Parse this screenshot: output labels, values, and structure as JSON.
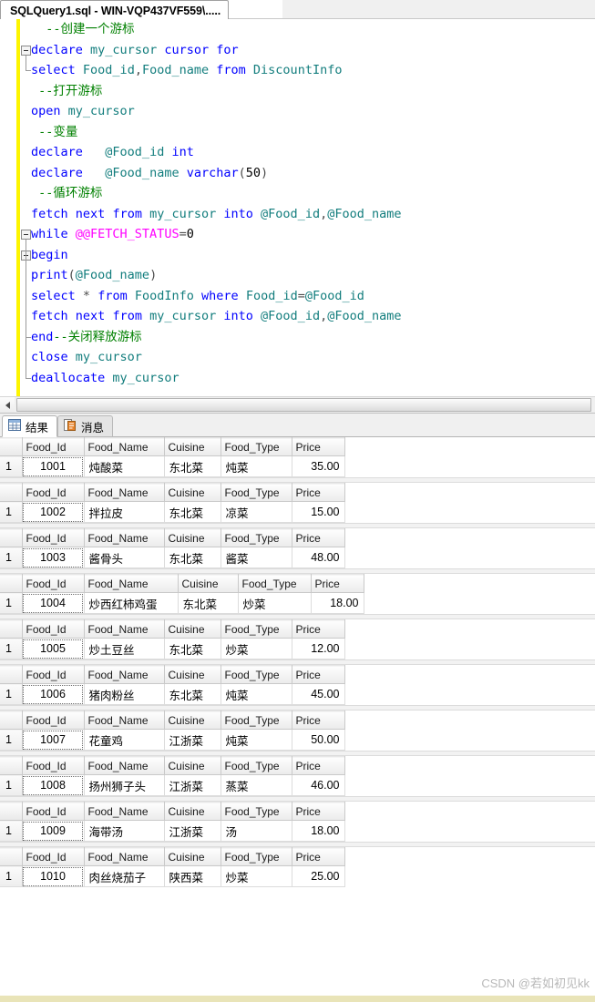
{
  "window": {
    "tab_title": "SQLQuery1.sql - WIN-VQP437VF559\\....."
  },
  "editor": {
    "lines": [
      {
        "glyph": "none",
        "segments": [
          {
            "t": "  --创建一个游标",
            "c": "cmt"
          }
        ]
      },
      {
        "glyph": "box",
        "segments": [
          {
            "t": "declare",
            "c": "kw"
          },
          {
            "t": " ",
            "c": "plain"
          },
          {
            "t": "my_cursor",
            "c": "id"
          },
          {
            "t": " ",
            "c": "plain"
          },
          {
            "t": "cursor",
            "c": "kw"
          },
          {
            "t": " ",
            "c": "plain"
          },
          {
            "t": "for",
            "c": "kw"
          }
        ]
      },
      {
        "glyph": "tick",
        "segments": [
          {
            "t": "select",
            "c": "kw"
          },
          {
            "t": " ",
            "c": "plain"
          },
          {
            "t": "Food_id",
            "c": "id"
          },
          {
            "t": ",",
            "c": "op"
          },
          {
            "t": "Food_name",
            "c": "id"
          },
          {
            "t": " ",
            "c": "plain"
          },
          {
            "t": "from",
            "c": "kw"
          },
          {
            "t": " ",
            "c": "plain"
          },
          {
            "t": "DiscountInfo",
            "c": "id"
          }
        ]
      },
      {
        "glyph": "none",
        "segments": [
          {
            "t": " --打开游标",
            "c": "cmt"
          }
        ]
      },
      {
        "glyph": "none",
        "segments": [
          {
            "t": "open",
            "c": "kw"
          },
          {
            "t": " ",
            "c": "plain"
          },
          {
            "t": "my_cursor",
            "c": "id"
          }
        ]
      },
      {
        "glyph": "none",
        "segments": [
          {
            "t": " --变量",
            "c": "cmt"
          }
        ]
      },
      {
        "glyph": "none",
        "segments": [
          {
            "t": "declare",
            "c": "kw"
          },
          {
            "t": "   ",
            "c": "plain"
          },
          {
            "t": "@Food_id",
            "c": "id"
          },
          {
            "t": " ",
            "c": "plain"
          },
          {
            "t": "int",
            "c": "kw"
          }
        ]
      },
      {
        "glyph": "none",
        "segments": [
          {
            "t": "declare",
            "c": "kw"
          },
          {
            "t": "   ",
            "c": "plain"
          },
          {
            "t": "@Food_name",
            "c": "id"
          },
          {
            "t": " ",
            "c": "plain"
          },
          {
            "t": "varchar",
            "c": "kw"
          },
          {
            "t": "(",
            "c": "op"
          },
          {
            "t": "50",
            "c": "num"
          },
          {
            "t": ")",
            "c": "op"
          }
        ]
      },
      {
        "glyph": "none",
        "segments": [
          {
            "t": " --循环游标",
            "c": "cmt"
          }
        ]
      },
      {
        "glyph": "none",
        "segments": [
          {
            "t": "fetch",
            "c": "kw"
          },
          {
            "t": " ",
            "c": "plain"
          },
          {
            "t": "next",
            "c": "kw"
          },
          {
            "t": " ",
            "c": "plain"
          },
          {
            "t": "from",
            "c": "kw"
          },
          {
            "t": " ",
            "c": "plain"
          },
          {
            "t": "my_cursor",
            "c": "id"
          },
          {
            "t": " ",
            "c": "plain"
          },
          {
            "t": "into",
            "c": "kw"
          },
          {
            "t": " ",
            "c": "plain"
          },
          {
            "t": "@Food_id",
            "c": "id"
          },
          {
            "t": ",",
            "c": "op"
          },
          {
            "t": "@Food_name",
            "c": "id"
          }
        ]
      },
      {
        "glyph": "box",
        "segments": [
          {
            "t": "while",
            "c": "kw"
          },
          {
            "t": " ",
            "c": "plain"
          },
          {
            "t": "@@FETCH_STATUS",
            "c": "gv"
          },
          {
            "t": "=",
            "c": "op"
          },
          {
            "t": "0",
            "c": "num"
          }
        ]
      },
      {
        "glyph": "box",
        "segments": [
          {
            "t": "begin",
            "c": "kw"
          }
        ]
      },
      {
        "glyph": "none",
        "segments": [
          {
            "t": "print",
            "c": "kw"
          },
          {
            "t": "(",
            "c": "op"
          },
          {
            "t": "@Food_name",
            "c": "id"
          },
          {
            "t": ")",
            "c": "op"
          }
        ]
      },
      {
        "glyph": "none",
        "segments": [
          {
            "t": "select",
            "c": "kw"
          },
          {
            "t": " ",
            "c": "plain"
          },
          {
            "t": "*",
            "c": "op"
          },
          {
            "t": " ",
            "c": "plain"
          },
          {
            "t": "from",
            "c": "kw"
          },
          {
            "t": " ",
            "c": "plain"
          },
          {
            "t": "FoodInfo",
            "c": "id"
          },
          {
            "t": " ",
            "c": "plain"
          },
          {
            "t": "where",
            "c": "kw"
          },
          {
            "t": " ",
            "c": "plain"
          },
          {
            "t": "Food_id",
            "c": "id"
          },
          {
            "t": "=",
            "c": "op"
          },
          {
            "t": "@Food_id",
            "c": "id"
          }
        ]
      },
      {
        "glyph": "none",
        "segments": [
          {
            "t": "fetch",
            "c": "kw"
          },
          {
            "t": " ",
            "c": "plain"
          },
          {
            "t": "next",
            "c": "kw"
          },
          {
            "t": " ",
            "c": "plain"
          },
          {
            "t": "from",
            "c": "kw"
          },
          {
            "t": " ",
            "c": "plain"
          },
          {
            "t": "my_cursor",
            "c": "id"
          },
          {
            "t": " ",
            "c": "plain"
          },
          {
            "t": "into",
            "c": "kw"
          },
          {
            "t": " ",
            "c": "plain"
          },
          {
            "t": "@Food_id",
            "c": "id"
          },
          {
            "t": ",",
            "c": "op"
          },
          {
            "t": "@Food_name",
            "c": "id"
          }
        ]
      },
      {
        "glyph": "tick",
        "segments": [
          {
            "t": "end",
            "c": "kw"
          },
          {
            "t": "--关闭释放游标",
            "c": "cmt"
          }
        ]
      },
      {
        "glyph": "none",
        "segments": [
          {
            "t": "close",
            "c": "kw"
          },
          {
            "t": " ",
            "c": "plain"
          },
          {
            "t": "my_cursor",
            "c": "id"
          }
        ]
      },
      {
        "glyph": "end",
        "segments": [
          {
            "t": "deallocate",
            "c": "kw"
          },
          {
            "t": " ",
            "c": "plain"
          },
          {
            "t": "my_cursor",
            "c": "id"
          }
        ]
      }
    ]
  },
  "results_tabs": [
    {
      "label": "结果",
      "icon": "grid-icon",
      "active": true
    },
    {
      "label": "消息",
      "icon": "messages-icon",
      "active": false
    }
  ],
  "grid": {
    "columns": [
      "Food_Id",
      "Food_Name",
      "Cuisine",
      "Food_Type",
      "Price"
    ],
    "row_number": "1",
    "result_sets": [
      {
        "widths": [
          68,
          88,
          62,
          78,
          58
        ],
        "cells": [
          "1001",
          "炖酸菜",
          "东北菜",
          "炖菜",
          "35.00"
        ]
      },
      {
        "widths": [
          68,
          88,
          62,
          78,
          58
        ],
        "cells": [
          "1002",
          "拌拉皮",
          "东北菜",
          "凉菜",
          "15.00"
        ]
      },
      {
        "widths": [
          68,
          88,
          62,
          78,
          58
        ],
        "cells": [
          "1003",
          "酱骨头",
          "东北菜",
          "酱菜",
          "48.00"
        ]
      },
      {
        "widths": [
          68,
          103,
          66,
          80,
          58
        ],
        "cells": [
          "1004",
          "炒西红柿鸡蛋",
          "东北菜",
          "炒菜",
          "18.00"
        ]
      },
      {
        "widths": [
          68,
          88,
          62,
          78,
          58
        ],
        "cells": [
          "1005",
          "炒土豆丝",
          "东北菜",
          "炒菜",
          "12.00"
        ]
      },
      {
        "widths": [
          68,
          88,
          62,
          78,
          58
        ],
        "cells": [
          "1006",
          "猪肉粉丝",
          "东北菜",
          "炖菜",
          "45.00"
        ]
      },
      {
        "widths": [
          68,
          88,
          62,
          78,
          58
        ],
        "cells": [
          "1007",
          "花童鸡",
          "江浙菜",
          "炖菜",
          "50.00"
        ]
      },
      {
        "widths": [
          68,
          88,
          62,
          78,
          58
        ],
        "cells": [
          "1008",
          "扬州狮子头",
          "江浙菜",
          "蒸菜",
          "46.00"
        ]
      },
      {
        "widths": [
          68,
          88,
          62,
          78,
          58
        ],
        "cells": [
          "1009",
          "海带汤",
          "江浙菜",
          "汤",
          "18.00"
        ]
      },
      {
        "widths": [
          68,
          88,
          62,
          78,
          58
        ],
        "cells": [
          "1010",
          "肉丝烧茄子",
          "陕西菜",
          "炒菜",
          "25.00"
        ]
      }
    ]
  },
  "watermark": {
    "text": "CSDN @若如初见kk"
  }
}
